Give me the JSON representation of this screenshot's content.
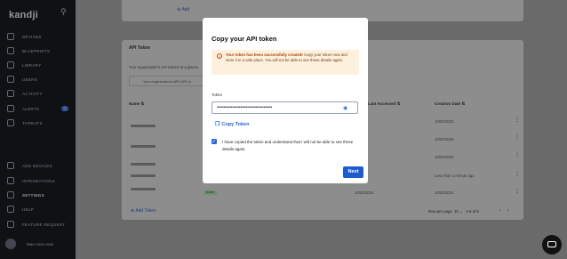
{
  "sidebar": {
    "logo": "kandji",
    "items": [
      {
        "label": "DEVICES",
        "icon": "laptop-icon"
      },
      {
        "label": "BLUEPRINTS",
        "icon": "blueprint-icon"
      },
      {
        "label": "LIBRARY",
        "icon": "library-icon"
      },
      {
        "label": "USERS",
        "icon": "users-icon"
      },
      {
        "label": "ACTIVITY",
        "icon": "activity-icon"
      },
      {
        "label": "ALERTS",
        "icon": "bell-icon"
      },
      {
        "label": "THREATS",
        "icon": "shield-icon"
      },
      {
        "label": "ADD DEVICES",
        "icon": "add-device-icon"
      },
      {
        "label": "INTEGRATIONS",
        "icon": "integrations-icon"
      },
      {
        "label": "SETTINGS",
        "icon": "gear-icon"
      },
      {
        "label": "HELP",
        "icon": "help-icon"
      },
      {
        "label": "FEATURE REQUEST",
        "icon": "feature-request-icon"
      }
    ],
    "alerts_count": "1",
    "user_name": "Man Anvo Auto"
  },
  "page": {
    "add_top": "Add",
    "section_title": "API Token",
    "section_desc": "Your organization's API tokens at a glance",
    "api_url_text": "Your organization's API URL is",
    "columns": [
      "Name",
      "Last Accessed",
      "Creation Date"
    ],
    "rows": [
      {
        "created": "10/02/2024"
      },
      {
        "created": "10/02/2024"
      },
      {
        "created": "10/02/2024"
      },
      {
        "created": "Less than 1 minute ago"
      },
      {
        "accessed": "10/02/2024",
        "created": "10/02/2024",
        "status": "Active"
      }
    ],
    "add_token": "Add Token",
    "rows_per_page_label": "Row per page",
    "rows_per_page": "10",
    "range": "1-5 of 5"
  },
  "modal": {
    "title": "Copy your API token",
    "alert_bold": "Your token has been successfully created!",
    "alert_rest": "Copy your token now and store it in a safe place. You will not be able to see these details again.",
    "token_label": "Token",
    "token_value": "••••••••••••••••••••••••••••••••••••••••",
    "copy_label": "Copy Token",
    "checkbox_text": "I have copied the token and understand that I will not be able to see these details again.",
    "next_label": "Next"
  },
  "colors": {
    "primary": "#1f5bd0",
    "alert_bg": "#fdf0dc",
    "sidebar_bg": "#0f1115"
  }
}
